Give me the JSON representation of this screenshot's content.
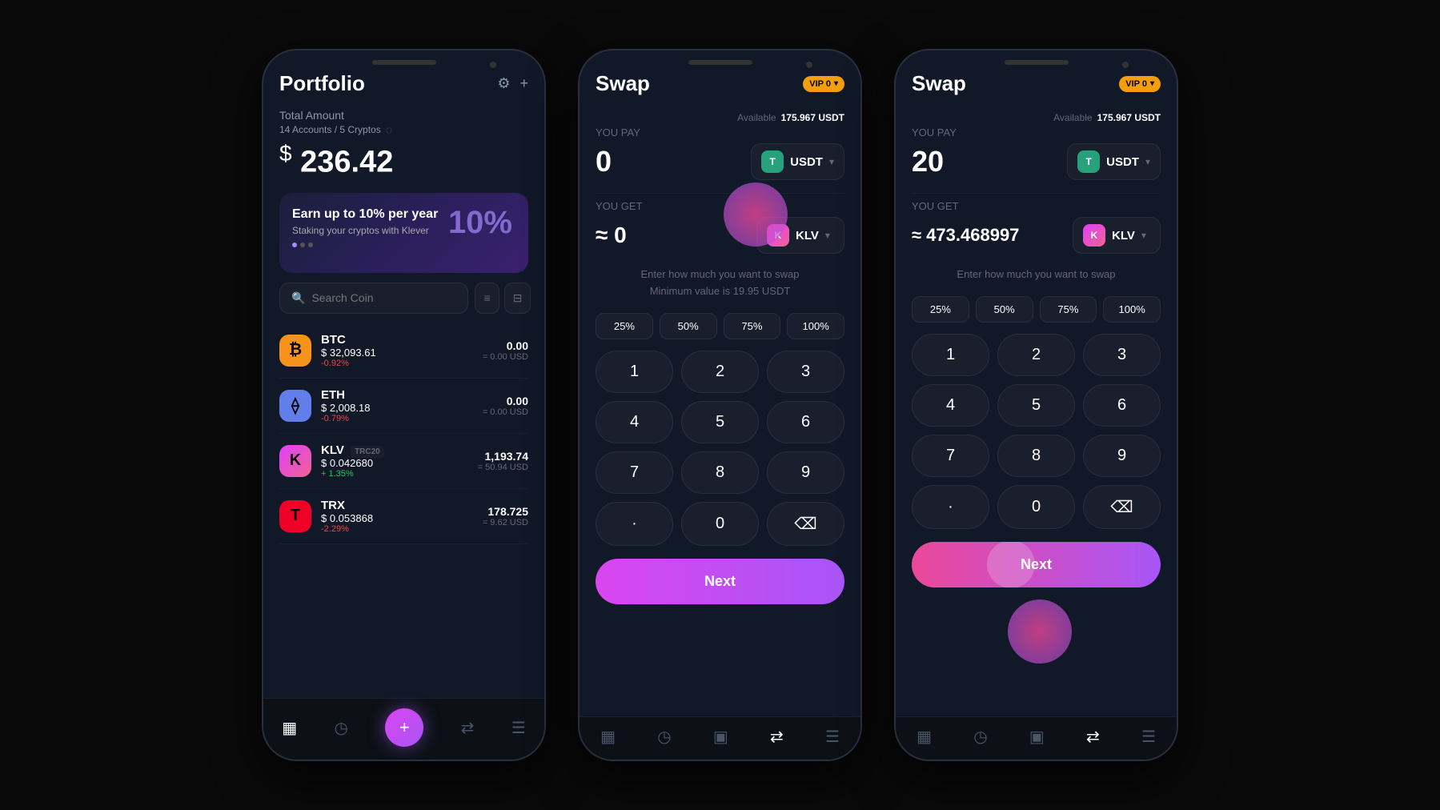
{
  "phone1": {
    "title": "Portfolio",
    "total_label": "Total Amount",
    "accounts_label": "14 Accounts / 5 Cryptos",
    "total_amount": "236.42",
    "banner": {
      "title": "Earn up to 10% per year",
      "subtitle": "Staking your cryptos with Klever",
      "percent": "10%"
    },
    "search": {
      "placeholder": "Search Coin"
    },
    "coins": [
      {
        "symbol": "BTC",
        "name": "BTC",
        "price": "$ 32,093.61",
        "change": "-0.92%",
        "change_type": "neg",
        "amount": "0.00",
        "usd": "= 0.00 USD",
        "icon_class": "btc",
        "icon_text": "₿"
      },
      {
        "symbol": "ETH",
        "name": "ETH",
        "price": "$ 2,008.18",
        "change": "-0.79%",
        "change_type": "neg",
        "amount": "0.00",
        "usd": "= 0.00 USD",
        "icon_class": "eth",
        "icon_text": "⟠"
      },
      {
        "symbol": "KLV",
        "name": "KLV",
        "tag": "TRC20",
        "price": "$ 0.042680",
        "change": "+ 1.35%",
        "change_type": "pos",
        "amount": "1,193.74",
        "usd": "= 50.94 USD",
        "icon_class": "klv",
        "icon_text": "K"
      },
      {
        "symbol": "TRX",
        "name": "TRX",
        "price": "$ 0.053868",
        "change": "-2.29%",
        "change_type": "neg",
        "amount": "178.725",
        "usd": "= 9.62 USD",
        "icon_class": "trx",
        "icon_text": "T"
      }
    ]
  },
  "phone2": {
    "title": "Swap",
    "vip": "VIP 0",
    "you_pay_label": "YOU PAY",
    "you_get_label": "YOU GET",
    "available_label": "Available",
    "available_amount": "175.967 USDT",
    "pay_amount": "0",
    "get_amount": "≈ 0",
    "pay_token": "USDT",
    "get_token": "KLV",
    "hint_line1": "Enter how much you want to swap",
    "hint_line2": "Minimum value is 19.95 USDT",
    "pct_buttons": [
      "25%",
      "50%",
      "75%",
      "100%"
    ],
    "numpad": [
      "1",
      "2",
      "3",
      "4",
      "5",
      "6",
      "7",
      "8",
      "9",
      ".",
      "0",
      "⌫"
    ],
    "next_label": "Next"
  },
  "phone3": {
    "title": "Swap",
    "vip": "VIP 0",
    "you_pay_label": "YOU PAY",
    "you_get_label": "YOU GET",
    "available_label": "Available",
    "available_amount": "175.967 USDT",
    "pay_amount": "20",
    "get_amount": "≈ 473.468997",
    "pay_token": "USDT",
    "get_token": "KLV",
    "hint_line1": "Enter how much you want to swap",
    "pct_buttons": [
      "25%",
      "50%",
      "75%",
      "100%"
    ],
    "numpad": [
      "1",
      "2",
      "3",
      "4",
      "5",
      "6",
      "7",
      "8",
      "9",
      ".",
      "0",
      "⌫"
    ],
    "next_label": "Next"
  },
  "icons": {
    "gear": "⚙",
    "plus": "+",
    "eye_off": "◌",
    "search": "🔍",
    "list": "≡",
    "filter": "⊟",
    "portfolio": "▦",
    "clock": "◷",
    "wallet": "▣",
    "swap": "⇄",
    "menu": "☰",
    "chevron": "▾",
    "backspace": "⌫",
    "dot": "·"
  }
}
